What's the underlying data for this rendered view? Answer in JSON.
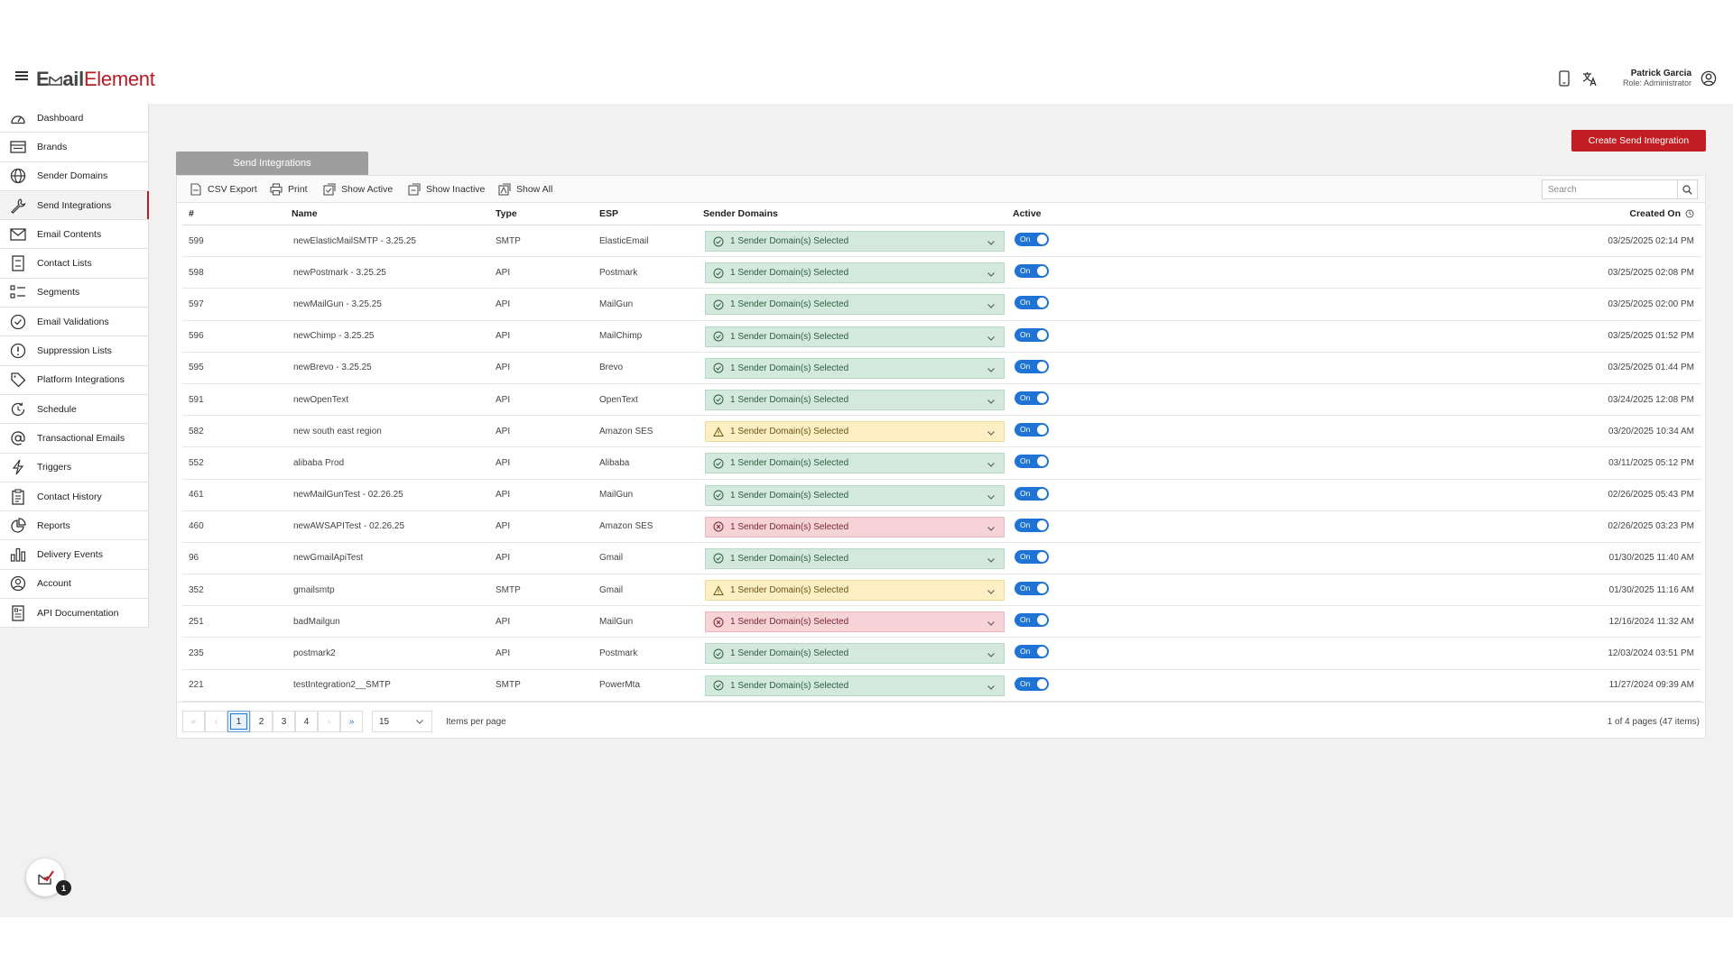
{
  "header": {
    "logo_part1": "E",
    "logo_part2": "ail",
    "logo_part3": "Element",
    "user_name": "Patrick Garcia",
    "user_role": "Role: Administrator"
  },
  "sidebar": {
    "items": [
      {
        "label": "Dashboard",
        "icon": "dashboard-icon"
      },
      {
        "label": "Brands",
        "icon": "brands-icon"
      },
      {
        "label": "Sender Domains",
        "icon": "globe-icon"
      },
      {
        "label": "Send Integrations",
        "icon": "wrench-icon",
        "active": true
      },
      {
        "label": "Email Contents",
        "icon": "envelope-icon"
      },
      {
        "label": "Contact Lists",
        "icon": "contact-list-icon"
      },
      {
        "label": "Segments",
        "icon": "segments-icon"
      },
      {
        "label": "Email Validations",
        "icon": "check-circle-icon"
      },
      {
        "label": "Suppression Lists",
        "icon": "alert-circle-icon"
      },
      {
        "label": "Platform Integrations",
        "icon": "tag-icon"
      },
      {
        "label": "Schedule",
        "icon": "schedule-icon"
      },
      {
        "label": "Transactional Emails",
        "icon": "at-sign-icon"
      },
      {
        "label": "Triggers",
        "icon": "bolt-icon"
      },
      {
        "label": "Contact History",
        "icon": "clipboard-icon"
      },
      {
        "label": "Reports",
        "icon": "pie-chart-icon"
      },
      {
        "label": "Delivery Events",
        "icon": "bar-chart-icon"
      },
      {
        "label": "Account",
        "icon": "user-circle-icon"
      },
      {
        "label": "API Documentation",
        "icon": "document-icon"
      }
    ],
    "fab_badge": "1"
  },
  "main": {
    "create_button": "Create Send Integration",
    "tab_label": "Send Integrations",
    "toolbar": {
      "csv_export": "CSV Export",
      "print": "Print",
      "show_active": "Show Active",
      "show_inactive": "Show Inactive",
      "show_all": "Show All",
      "search_placeholder": "Search"
    },
    "columns": {
      "id": "#",
      "name": "Name",
      "type": "Type",
      "esp": "ESP",
      "domains": "Sender Domains",
      "active": "Active",
      "created": "Created On"
    },
    "rows": [
      {
        "id": "599",
        "name": "newElasticMailSMTP - 3.25.25",
        "type": "SMTP",
        "esp": "ElasticEmail",
        "domains": "1 Sender Domain(s) Selected",
        "status": "ok",
        "active": "On",
        "created": "03/25/2025 02:14 PM"
      },
      {
        "id": "598",
        "name": "newPostmark - 3.25.25",
        "type": "API",
        "esp": "Postmark",
        "domains": "1 Sender Domain(s) Selected",
        "status": "ok",
        "active": "On",
        "created": "03/25/2025 02:08 PM"
      },
      {
        "id": "597",
        "name": "newMailGun - 3.25.25",
        "type": "API",
        "esp": "MailGun",
        "domains": "1 Sender Domain(s) Selected",
        "status": "ok",
        "active": "On",
        "created": "03/25/2025 02:00 PM"
      },
      {
        "id": "596",
        "name": "newChimp - 3.25.25",
        "type": "API",
        "esp": "MailChimp",
        "domains": "1 Sender Domain(s) Selected",
        "status": "ok",
        "active": "On",
        "created": "03/25/2025 01:52 PM"
      },
      {
        "id": "595",
        "name": "newBrevo - 3.25.25",
        "type": "API",
        "esp": "Brevo",
        "domains": "1 Sender Domain(s) Selected",
        "status": "ok",
        "active": "On",
        "created": "03/25/2025 01:44 PM"
      },
      {
        "id": "591",
        "name": "newOpenText",
        "type": "API",
        "esp": "OpenText",
        "domains": "1 Sender Domain(s) Selected",
        "status": "ok",
        "active": "On",
        "created": "03/24/2025 12:08 PM"
      },
      {
        "id": "582",
        "name": "new south east region",
        "type": "API",
        "esp": "Amazon SES",
        "domains": "1 Sender Domain(s) Selected",
        "status": "warn",
        "active": "On",
        "created": "03/20/2025 10:34 AM"
      },
      {
        "id": "552",
        "name": "alibaba Prod",
        "type": "API",
        "esp": "Alibaba",
        "domains": "1 Sender Domain(s) Selected",
        "status": "ok",
        "active": "On",
        "created": "03/11/2025 05:12 PM"
      },
      {
        "id": "461",
        "name": "newMailGunTest - 02.26.25",
        "type": "API",
        "esp": "MailGun",
        "domains": "1 Sender Domain(s) Selected",
        "status": "ok",
        "active": "On",
        "created": "02/26/2025 05:43 PM"
      },
      {
        "id": "460",
        "name": "newAWSAPITest - 02.26.25",
        "type": "API",
        "esp": "Amazon SES",
        "domains": "1 Sender Domain(s) Selected",
        "status": "err",
        "active": "On",
        "created": "02/26/2025 03:23 PM"
      },
      {
        "id": "96",
        "name": "newGmailApiTest",
        "type": "API",
        "esp": "Gmail",
        "domains": "1 Sender Domain(s) Selected",
        "status": "ok",
        "active": "On",
        "created": "01/30/2025 11:40 AM"
      },
      {
        "id": "352",
        "name": "gmailsmtp",
        "type": "SMTP",
        "esp": "Gmail",
        "domains": "1 Sender Domain(s) Selected",
        "status": "warn",
        "active": "On",
        "created": "01/30/2025 11:16 AM"
      },
      {
        "id": "251",
        "name": "badMailgun",
        "type": "API",
        "esp": "MailGun",
        "domains": "1 Sender Domain(s) Selected",
        "status": "err",
        "active": "On",
        "created": "12/16/2024 11:32 AM"
      },
      {
        "id": "235",
        "name": "postmark2",
        "type": "API",
        "esp": "Postmark",
        "domains": "1 Sender Domain(s) Selected",
        "status": "ok",
        "active": "On",
        "created": "12/03/2024 03:51 PM"
      },
      {
        "id": "221",
        "name": "testIntegration2__SMTP",
        "type": "SMTP",
        "esp": "PowerMta",
        "domains": "1 Sender Domain(s) Selected",
        "status": "ok",
        "active": "On",
        "created": "11/27/2024 09:39 AM"
      }
    ],
    "pager": {
      "first": "«",
      "prev": "‹",
      "pages": [
        "1",
        "2",
        "3",
        "4"
      ],
      "current": "1",
      "next": "›",
      "last": "»",
      "per_page": "15",
      "per_page_label": "Items per page",
      "info": "1 of 4 pages (47 items)"
    }
  },
  "colors": {
    "brand_red": "#c41e24",
    "toggle_blue": "#1e73d4",
    "status_ok": "#d3e9dd",
    "status_warn": "#fcefc4",
    "status_err": "#f6d3d7"
  }
}
